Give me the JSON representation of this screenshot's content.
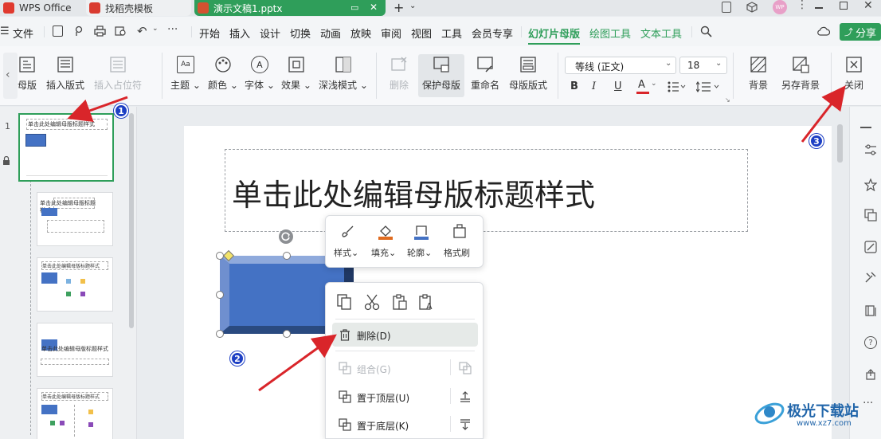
{
  "tabs": [
    {
      "label": "WPS Office",
      "icon": "wps-logo-icon",
      "color": "#e03a2f"
    },
    {
      "label": "找稻壳模板",
      "icon": "docer-icon",
      "color": "#d93b30"
    },
    {
      "label": "演示文稿1.pptx",
      "icon": "ppt-icon",
      "color": "#d35230"
    }
  ],
  "window": {
    "avatar_text": "WP"
  },
  "menu": {
    "file": "文件",
    "items": [
      "开始",
      "插入",
      "设计",
      "切换",
      "动画",
      "放映",
      "审阅",
      "视图",
      "工具",
      "会员专享",
      "幻灯片母版",
      "绘图工具",
      "文本工具"
    ],
    "active": "幻灯片母版",
    "share": "分享"
  },
  "ribbon": {
    "buttons": {
      "master_layout": "母版",
      "insert_layout": "插入版式",
      "insert_placeholder": "插入占位符",
      "theme": "主题",
      "color": "颜色",
      "font": "字体",
      "effect": "效果",
      "shade_mode": "深浅模式",
      "delete": "删除",
      "protect_master": "保护母版",
      "rename": "重命名",
      "master_layout_style": "母版版式",
      "background": "背景",
      "save_background": "另存背景",
      "close": "关闭"
    },
    "font_name": "等线 (正文)",
    "font_size": "18",
    "format": {
      "bold": "B",
      "italic": "I",
      "underline": "U",
      "font_color": "A"
    }
  },
  "thumbnails": {
    "index": "1",
    "items": [
      {
        "title": "单击此处编辑母版标题样式"
      },
      {
        "title": "单击此处编辑母版标题样式"
      },
      {
        "title": "单击此处编辑母版标题样式"
      },
      {
        "title": "单击此处编辑母版标题样式"
      },
      {
        "title": "单击此处编辑母版标题样式"
      }
    ]
  },
  "slide": {
    "title_placeholder": "单击此处编辑母版标题样式"
  },
  "shape_toolbar": {
    "style": "样式",
    "fill": "填充",
    "outline": "轮廓",
    "format_painter": "格式刷"
  },
  "context_menu": {
    "delete": "删除(D)",
    "group": "组合(G)",
    "bring_front": "置于顶层(U)",
    "send_back": "置于底层(K)"
  },
  "annotations": {
    "step1": "1",
    "step2": "2",
    "step3": "3"
  },
  "watermark": {
    "text": "极光下载站",
    "url": "www.xz7.com"
  },
  "colors": {
    "accent_green": "#2f9e5a",
    "shape_blue": "#4472c4",
    "arrow_red": "#d9252a",
    "marker_blue": "#1d3fc4"
  }
}
